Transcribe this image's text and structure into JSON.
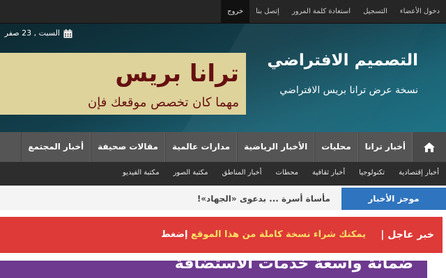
{
  "topbar": {
    "links": [
      "دخول الأعضاء",
      "التسجيل",
      "استعادة كلمة المرور",
      "إتصل بنا",
      "خروج"
    ],
    "active_index": 4
  },
  "header": {
    "date": "السبت , 23 صفر",
    "calendar_icon": "calendar-icon",
    "site_title": "التصميم الافتراضي",
    "site_subtitle": "نسخة عرض ترانا بريس الافتراضي",
    "ad_title": "ترانا بريس",
    "ad_subtitle": "مهما كان تخصص موقعك فإن"
  },
  "main_nav": {
    "home_icon": "home-icon",
    "items": [
      "أخبار ترانا",
      "محليات",
      "الأخبار الرياضية",
      "مدارات عالمية",
      "مقالات صحيفة",
      "أخبار المجتمع"
    ]
  },
  "sub_nav": {
    "items": [
      "أخبار إقتصادية",
      "تكنولوجيا",
      "أخبار ثقافية",
      "محطات",
      "أخبار المناطق",
      "مكتبة الصور",
      "مكتبة الفيديو"
    ]
  },
  "ticker": {
    "label": "موجز الأخبار",
    "text": "مأساة أسرة ... بدعوى «الجهاد»!"
  },
  "breaking": {
    "label": "خبر عاجل |",
    "text": "يمكنك شراء نسخة كاملة من هذا الموقع",
    "click": "إضغط"
  },
  "purple_banner": {
    "text": "ضمانة واسعة خدمات الاستضافة"
  },
  "colors": {
    "topbar": "#262626",
    "header_gradient_dark": "#0d2830",
    "header_gradient_light": "#1e7386",
    "ad_background": "#ded39b",
    "ad_text": "#661010",
    "main_nav": "#555555",
    "sub_nav": "#2d2d2d",
    "ticker_label": "#2f74be",
    "breaking": "#dd3a38",
    "breaking_text": "#ffe066",
    "purple_banner": "#6d3a8f"
  }
}
